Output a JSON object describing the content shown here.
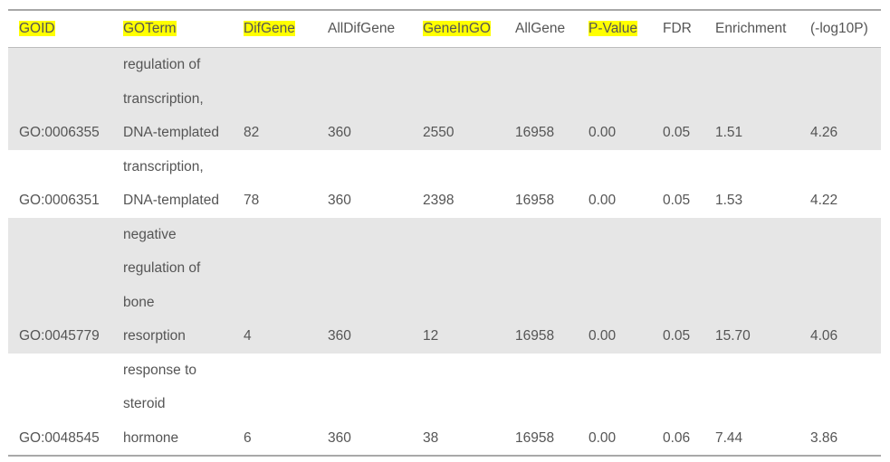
{
  "headers": [
    {
      "label": "GOID",
      "highlight": true
    },
    {
      "label": "GOTerm",
      "highlight": true
    },
    {
      "label": "DifGene",
      "highlight": true
    },
    {
      "label": "AllDifGene",
      "highlight": false
    },
    {
      "label": "GeneInGO",
      "highlight": true
    },
    {
      "label": "AllGene",
      "highlight": false
    },
    {
      "label": "P-Value",
      "highlight": true
    },
    {
      "label": "FDR",
      "highlight": false
    },
    {
      "label": "Enrichment",
      "highlight": false
    },
    {
      "label": "(-log10P)",
      "highlight": false
    }
  ],
  "highlight_color": "#ffff00",
  "rows": [
    {
      "goid": "GO:0006355",
      "term_lines": [
        "regulation of",
        "transcription,",
        "DNA-templated"
      ],
      "difgene": "82",
      "alldifgene": "360",
      "geneingo": "2550",
      "allgene": "16958",
      "pvalue": "0.00",
      "fdr": "0.05",
      "enrichment": "1.51",
      "neglog10p": "4.26"
    },
    {
      "goid": "GO:0006351",
      "term_lines": [
        "transcription,",
        "DNA-templated"
      ],
      "difgene": "78",
      "alldifgene": "360",
      "geneingo": "2398",
      "allgene": "16958",
      "pvalue": "0.00",
      "fdr": "0.05",
      "enrichment": "1.53",
      "neglog10p": "4.22"
    },
    {
      "goid": "GO:0045779",
      "term_lines": [
        "negative",
        "regulation of",
        "bone",
        "resorption"
      ],
      "difgene": "4",
      "alldifgene": "360",
      "geneingo": "12",
      "allgene": "16958",
      "pvalue": "0.00",
      "fdr": "0.05",
      "enrichment": "15.70",
      "neglog10p": "4.06"
    },
    {
      "goid": "GO:0048545",
      "term_lines": [
        "response to",
        "steroid",
        "hormone"
      ],
      "difgene": "6",
      "alldifgene": "360",
      "geneingo": "38",
      "allgene": "16958",
      "pvalue": "0.00",
      "fdr": "0.06",
      "enrichment": "7.44",
      "neglog10p": "3.86"
    }
  ]
}
